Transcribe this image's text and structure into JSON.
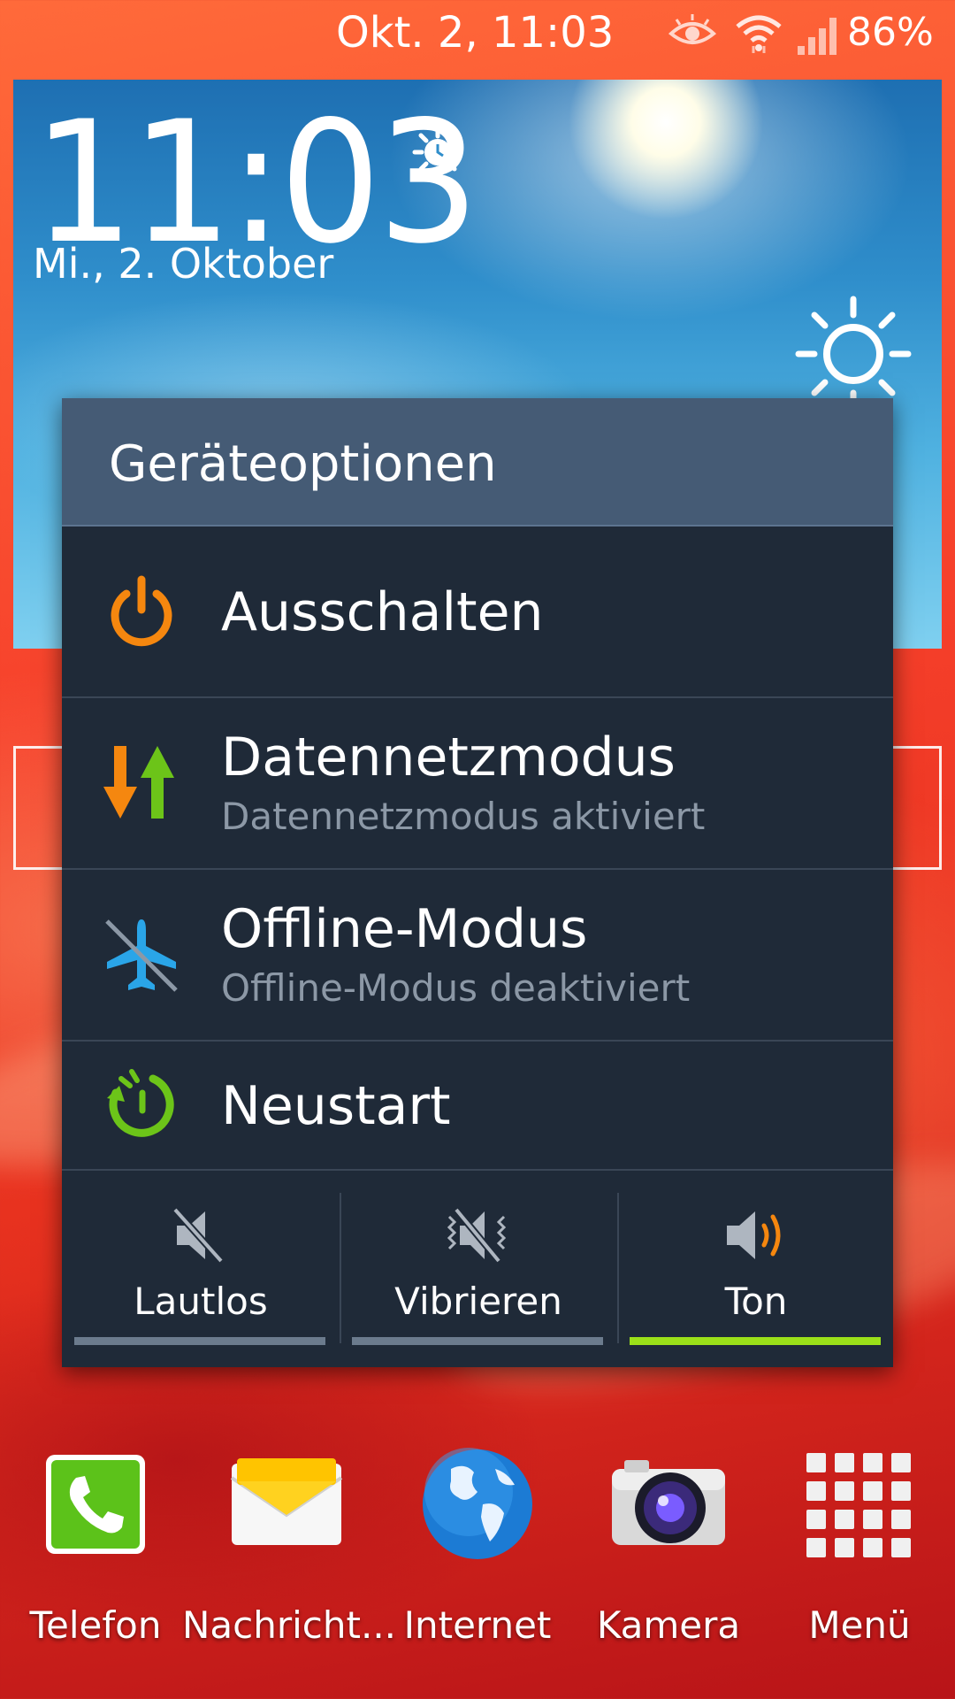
{
  "status_bar": {
    "datetime": "Okt. 2, 11:03",
    "battery": "86%",
    "icons": [
      "eye-icon",
      "wifi-icon",
      "signal-icon"
    ]
  },
  "widget": {
    "time": "11:03",
    "date": "Mi., 2. Oktober",
    "icons": [
      "alarm-icon",
      "sunny-weather-icon"
    ]
  },
  "dialog": {
    "title": "Geräteoptionen",
    "options": [
      {
        "title": "Ausschalten",
        "subtitle": "",
        "icon": "power-icon"
      },
      {
        "title": "Datennetzmodus",
        "subtitle": "Datennetzmodus aktiviert",
        "icon": "data-network-icon"
      },
      {
        "title": "Offline-Modus",
        "subtitle": "Offline-Modus deaktiviert",
        "icon": "airplane-off-icon"
      },
      {
        "title": "Neustart",
        "subtitle": "",
        "icon": "restart-icon"
      }
    ],
    "sound_modes": [
      {
        "label": "Lautlos",
        "icon": "mute-icon",
        "selected": false
      },
      {
        "label": "Vibrieren",
        "icon": "vibrate-icon",
        "selected": false
      },
      {
        "label": "Ton",
        "icon": "sound-icon",
        "selected": true
      }
    ],
    "colors": {
      "selected_bar": "#9be019",
      "unselected_bar": "#6b7b8d",
      "header": "#455b75",
      "body": "#1f2a38"
    }
  },
  "dock": [
    {
      "label": "Telefon",
      "icon": "phone-icon"
    },
    {
      "label": "Nachricht...",
      "icon": "messages-icon"
    },
    {
      "label": "Internet",
      "icon": "globe-icon"
    },
    {
      "label": "Kamera",
      "icon": "camera-icon"
    },
    {
      "label": "Menü",
      "icon": "apps-grid-icon"
    }
  ]
}
